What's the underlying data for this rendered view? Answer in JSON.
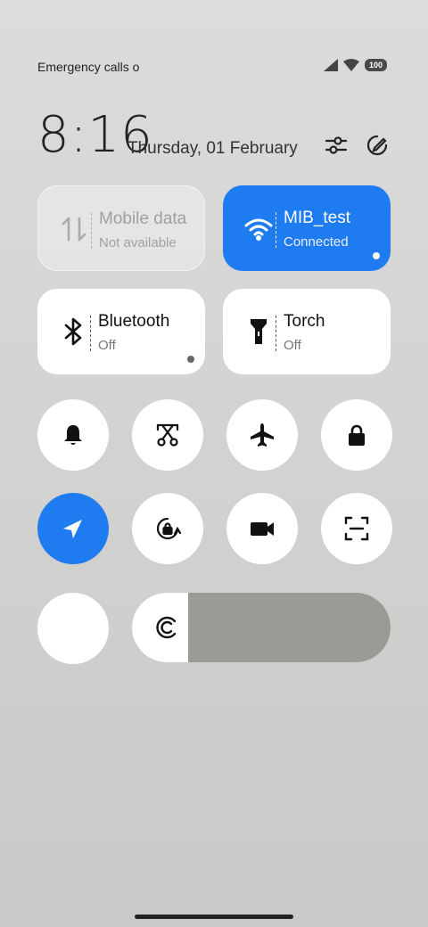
{
  "status_bar": {
    "left_text": "Emergency calls o",
    "battery": "100"
  },
  "clock": {
    "time": "8:16",
    "date": "Thursday, 01 February"
  },
  "tiles": {
    "mobile_data": {
      "title": "Mobile data",
      "subtitle": "Not available",
      "state": "disabled"
    },
    "wifi": {
      "title": "MIB_test",
      "subtitle": "Connected",
      "state": "on"
    },
    "bluetooth": {
      "title": "Bluetooth",
      "subtitle": "Off",
      "state": "off"
    },
    "torch": {
      "title": "Torch",
      "subtitle": "Off",
      "state": "off"
    }
  },
  "toggles": [
    {
      "name": "bell-icon",
      "state": "off"
    },
    {
      "name": "screenshot-icon",
      "state": "off"
    },
    {
      "name": "airplane-icon",
      "state": "off"
    },
    {
      "name": "lock-icon",
      "state": "off"
    },
    {
      "name": "location-icon",
      "state": "on"
    },
    {
      "name": "rotation-lock-icon",
      "state": "off"
    },
    {
      "name": "video-camera-icon",
      "state": "off"
    },
    {
      "name": "scan-icon",
      "state": "off"
    },
    {
      "name": "blank-toggle",
      "state": "off"
    }
  ],
  "brightness": {
    "level": 0.22
  },
  "colors": {
    "accent": "#1e7bf0",
    "tile_bg": "#ffffff"
  }
}
